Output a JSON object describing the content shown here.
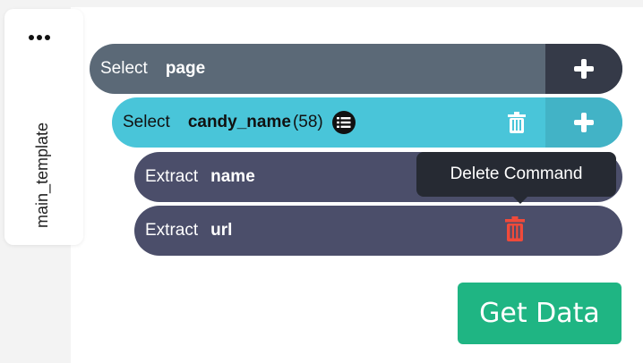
{
  "sidebar": {
    "label": "main_template",
    "menu_icon": "ellipsis-icon"
  },
  "commands": [
    {
      "keyword": "Select",
      "value": "page",
      "action_icon": "plus-icon"
    },
    {
      "keyword": "Select",
      "value": "candy_name",
      "count": "(58)",
      "icons": [
        "list-icon",
        "trash-icon",
        "plus-icon"
      ]
    },
    {
      "keyword": "Extract",
      "value": "name"
    },
    {
      "keyword": "Extract",
      "value": "url",
      "icons": [
        "trash-icon"
      ]
    }
  ],
  "tooltip": {
    "text": "Delete Command"
  },
  "get_data": {
    "label": "Get Data"
  },
  "colors": {
    "page_row": "#5b6977",
    "select_row": "#49c5d9",
    "extract_row": "#4b4e6a",
    "delete_active": "#f04a3a",
    "button": "#1fb583"
  }
}
